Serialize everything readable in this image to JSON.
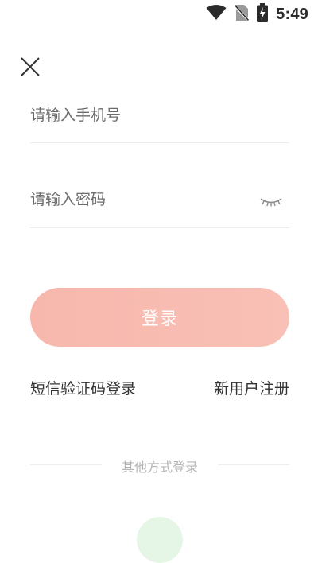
{
  "status_bar": {
    "time": "5:49",
    "icons": [
      "wifi-icon",
      "no-sim-icon",
      "battery-charging-icon"
    ]
  },
  "close": {
    "icon": "close-icon"
  },
  "form": {
    "phone_placeholder": "请输入手机号",
    "password_placeholder": "请输入密码",
    "password_toggle_icon": "eye-closed-icon",
    "login_label": "登录"
  },
  "links": {
    "sms_login": "短信验证码登录",
    "register": "新用户注册"
  },
  "other": {
    "divider_text": "其他方式登录",
    "wechat_icon": "wechat-icon"
  },
  "colors": {
    "login_button": "#f8bcb1",
    "divider_text": "#b5b5b5",
    "wechat_circle": "#e6f6e6"
  }
}
